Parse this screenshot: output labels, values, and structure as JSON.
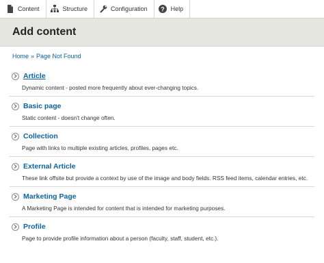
{
  "toolbar": {
    "items": [
      {
        "label": "Content",
        "icon": "document-icon"
      },
      {
        "label": "Structure",
        "icon": "sitemap-icon"
      },
      {
        "label": "Configuration",
        "icon": "wrench-icon"
      },
      {
        "label": "Help",
        "icon": "help-icon"
      }
    ]
  },
  "header": {
    "title": "Add content"
  },
  "breadcrumb": {
    "home": "Home",
    "separator": "»",
    "current": "Page Not Found"
  },
  "content_types": [
    {
      "title": "Article",
      "description": "Dynamic content - posted more frequently about ever-changing topics."
    },
    {
      "title": "Basic page",
      "description": "Static content - doesn't change often."
    },
    {
      "title": "Collection",
      "description": "Page with links to multiple existing articles, profiles, pages etc."
    },
    {
      "title": "External Article",
      "description": "These link offsite but provide a context by use of the image and body fields. RSS feed items, calendar entries, etc."
    },
    {
      "title": "Marketing Page",
      "description": "A Marketing Page is intended for content that is intended for marketing purposes."
    },
    {
      "title": "Profile",
      "description": "Page to provide profile information about a person (faculty, staff, student, etc.)."
    }
  ],
  "colors": {
    "link": "#0a62a8",
    "header_bg": "#e6e6e0"
  }
}
